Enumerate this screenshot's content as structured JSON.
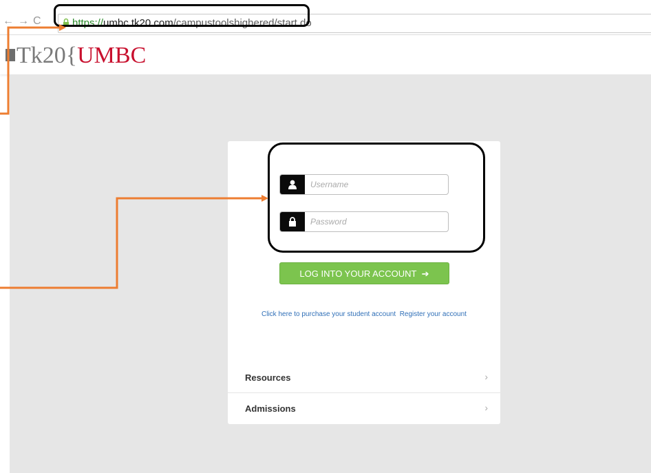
{
  "browser": {
    "url_scheme": "https://",
    "url_host": "umbc.tk20.com",
    "url_path": "/campustoolshighered/start.do"
  },
  "header": {
    "logo_prefix": "Tk20",
    "logo_brace": "{",
    "logo_brand": "UMBC"
  },
  "login": {
    "username_placeholder": "Username",
    "password_placeholder": "Password",
    "button_label": "LOG INTO YOUR ACCOUNT",
    "button_arrow": "➔",
    "purchase_link": "Click here to purchase your student account",
    "register_link": "Register your account"
  },
  "menu": {
    "items": [
      {
        "label": "Resources",
        "chevron": "›"
      },
      {
        "label": "Admissions",
        "chevron": "›"
      }
    ]
  },
  "colors": {
    "accent": "#c8102e",
    "login_button": "#7cc44e",
    "annotation_arrow": "#ed7d31"
  }
}
